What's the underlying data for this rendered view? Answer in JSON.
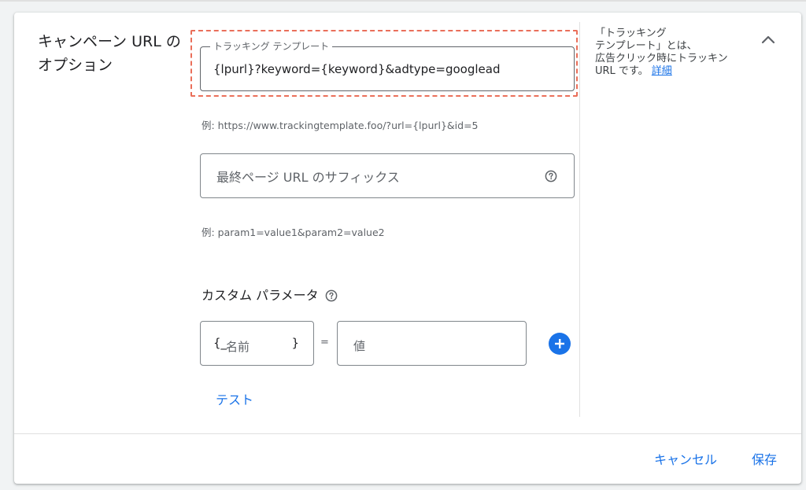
{
  "section": {
    "title_line1": "キャンペーン URL の",
    "title_line2": "オプション"
  },
  "help": {
    "line1": "「トラッキング",
    "line2": "テンプレート」とは、",
    "line3": "広告クリック時にトラッキン",
    "line4_text": "URL です。",
    "link": "詳細"
  },
  "tracking_template": {
    "label": "トラッキング テンプレート",
    "value": "{lpurl}?keyword={keyword}&adtype=googlead",
    "example": "例: https://www.trackingtemplate.foo/?url={lpurl}&id=5"
  },
  "final_url_suffix": {
    "placeholder": "最終ページ URL のサフィックス",
    "example": "例: param1=value1&param2=value2"
  },
  "custom_params": {
    "title": "カスタム パラメータ",
    "name_prefix": "{_",
    "name_placeholder": "名前",
    "name_suffix": "}",
    "equals": "=",
    "value_placeholder": "値"
  },
  "buttons": {
    "test": "テスト",
    "cancel": "キャンセル",
    "save": "保存"
  },
  "colors": {
    "accent": "#1a73e8",
    "highlight_dashed": "#ea6f5a",
    "border": "#5f6368"
  }
}
